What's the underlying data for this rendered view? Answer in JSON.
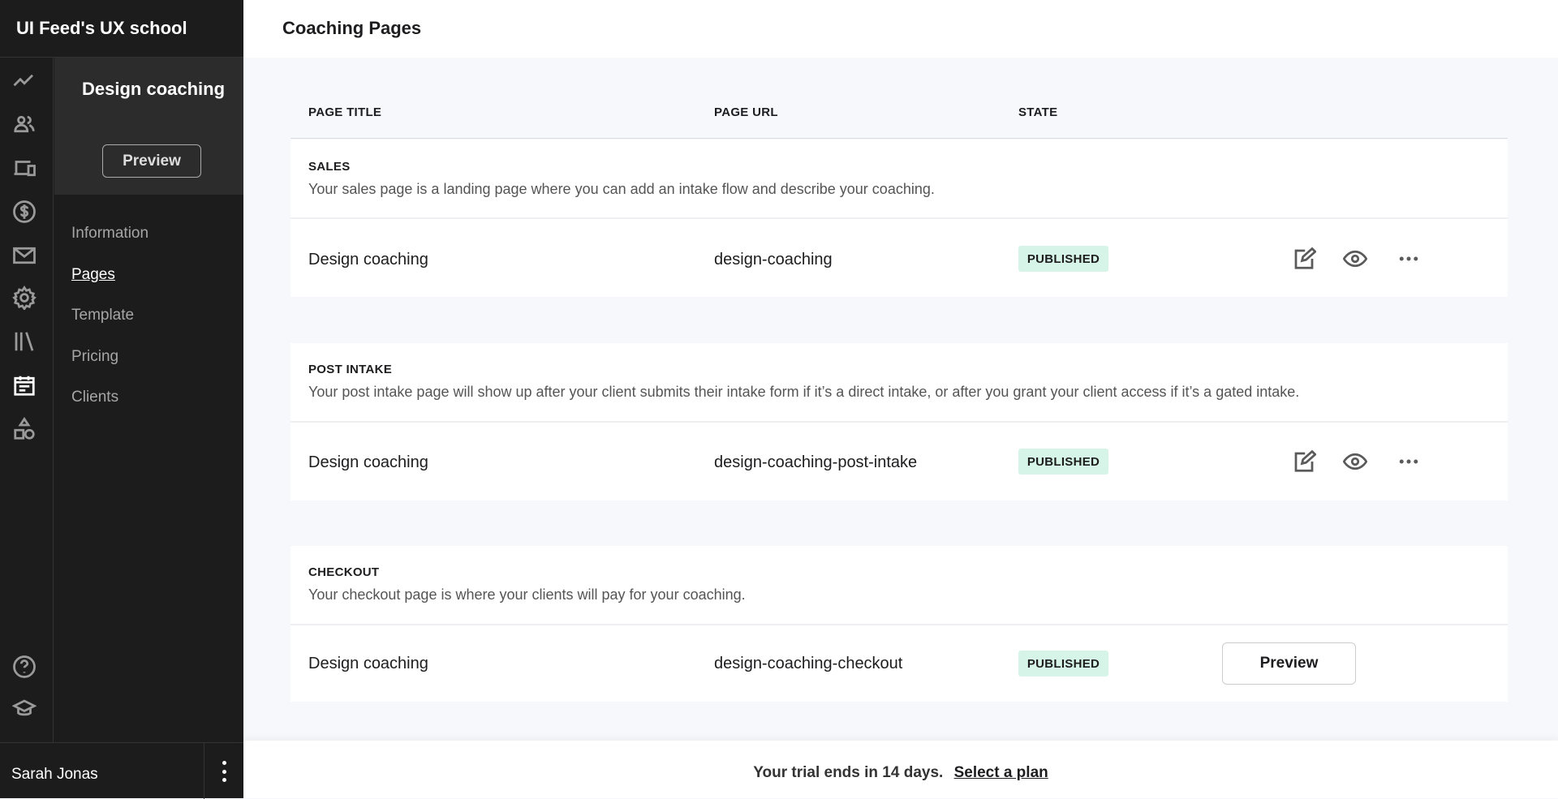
{
  "app": {
    "title": "UI Feed's UX school"
  },
  "rail": {
    "icons": [
      "analytics-icon",
      "users-icon",
      "devices-icon",
      "dollar-icon",
      "mail-icon",
      "gear-icon",
      "library-icon",
      "calendar-icon",
      "shapes-icon",
      "help-icon",
      "graduation-cap-icon"
    ],
    "active": "calendar-icon"
  },
  "panel": {
    "title": "Design coaching",
    "preview_label": "Preview"
  },
  "nav": {
    "items": [
      {
        "label": "Information"
      },
      {
        "label": "Pages",
        "active": true
      },
      {
        "label": "Template"
      },
      {
        "label": "Pricing"
      },
      {
        "label": "Clients"
      }
    ]
  },
  "user": {
    "name": "Sarah Jonas"
  },
  "header": {
    "title": "Coaching Pages"
  },
  "table": {
    "columns": [
      "PAGE TITLE",
      "PAGE URL",
      "STATE"
    ],
    "sections": [
      {
        "label": "SALES",
        "description": "Your sales page is a landing page where you can add an intake flow and describe your coaching.",
        "row": {
          "title": "Design coaching",
          "url": "design-coaching",
          "state": "PUBLISHED"
        }
      },
      {
        "label": "POST INTAKE",
        "description": "Your post intake page will show up after your client submits their intake form if it’s a direct intake, or after you grant your client access if it’s a gated intake.",
        "row": {
          "title": "Design coaching",
          "url": "design-coaching-post-intake",
          "state": "PUBLISHED"
        }
      },
      {
        "label": "CHECKOUT",
        "description": "Your checkout page is where your clients will pay for your coaching.",
        "row": {
          "title": "Design coaching",
          "url": "design-coaching-checkout",
          "state": "PUBLISHED",
          "preview_label": "Preview"
        }
      }
    ]
  },
  "footer": {
    "trial_text": "Your trial ends in 14 days.",
    "select_plan": "Select a plan"
  },
  "colors": {
    "sidebar": "#1c1c1c",
    "badge": "#d6f5e8",
    "background": "#f7f8fc"
  }
}
